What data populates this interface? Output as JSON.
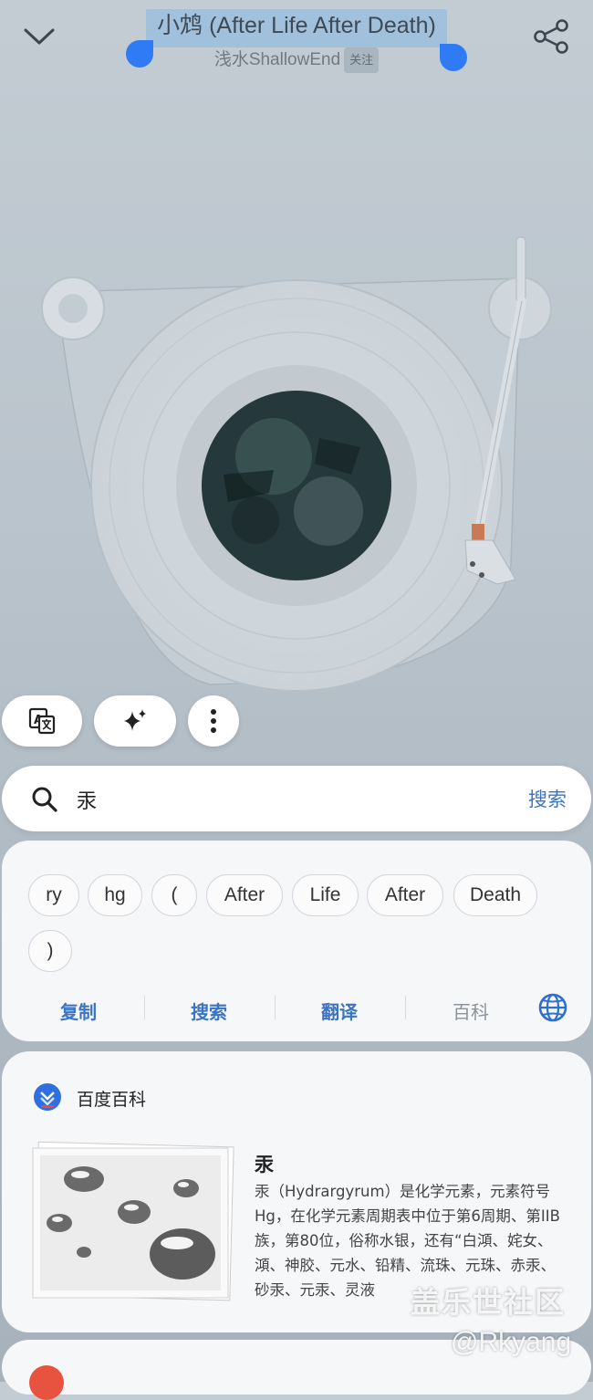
{
  "header": {
    "title": "小鸩 (After Life After Death)",
    "artist": "浅水ShallowEnd",
    "follow_label": "关注"
  },
  "icons": {
    "collapse": "chevron-down-icon",
    "share": "share-icon",
    "translate": "translate-icon",
    "ai": "sparkle-icon",
    "more": "more-vertical-icon",
    "search": "search-icon",
    "globe": "globe-icon",
    "baike_logo": "baidu-baike-logo"
  },
  "search": {
    "query": "汞",
    "action_label": "搜索"
  },
  "tokens": {
    "chips": [
      "ry",
      "hg",
      "(",
      "After",
      "Life",
      "After",
      "Death",
      ")"
    ],
    "actions": [
      "复制",
      "搜索",
      "翻译",
      "百科"
    ]
  },
  "baike": {
    "source": "百度百科",
    "entry_title": "汞",
    "entry_desc": "汞（Hydrargyrum）是化学元素，元素符号Hg，在化学元素周期表中位于第6周期、第IIB族，第80位，俗称水银，还有“白澒、姹女、澒、神胶、元水、铅精、流珠、元珠、赤汞、砂汞、元汞、灵液"
  },
  "watermark": {
    "line1": "盖乐世社区",
    "line2": "@Rkyang"
  },
  "colors": {
    "accent": "#3b74c4",
    "selection_handle": "#2f7bf5"
  }
}
